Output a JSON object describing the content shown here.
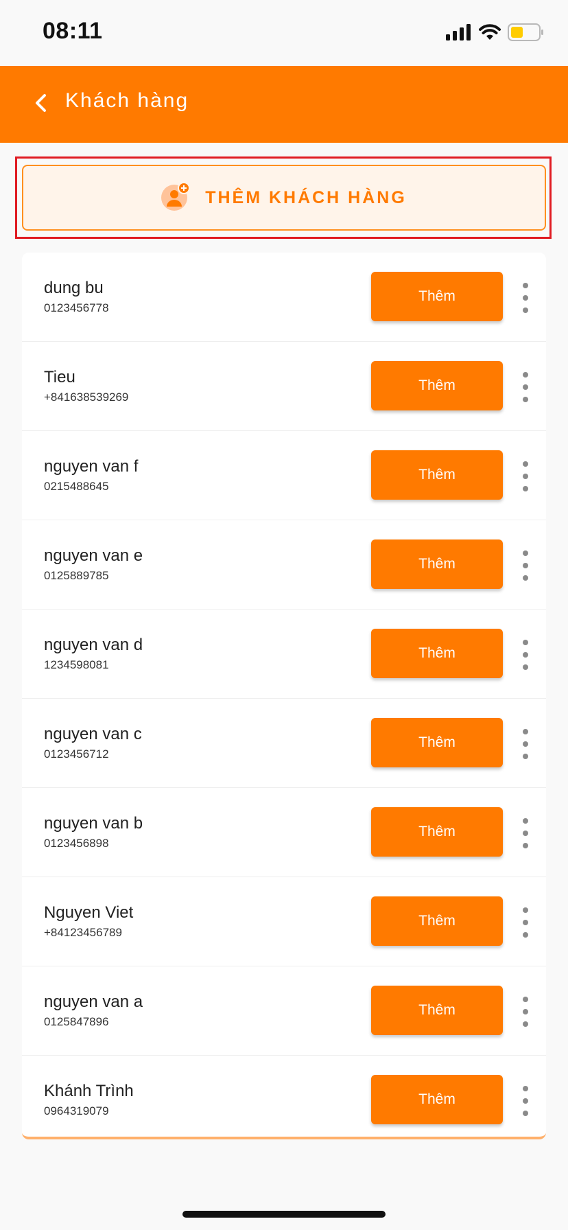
{
  "status_bar": {
    "time": "08:11",
    "icons": [
      "signal-icon",
      "wifi-icon",
      "battery-icon"
    ]
  },
  "header": {
    "title": "Khách hàng",
    "back_icon": "chevron-left-icon"
  },
  "add_customer": {
    "label": "THÊM KHÁCH HÀNG",
    "icon": "add-user-icon"
  },
  "customers": [
    {
      "name": "dung bu",
      "phone": "0123456778",
      "button_label": "Thêm"
    },
    {
      "name": "Tieu",
      "phone": "+841638539269",
      "button_label": "Thêm"
    },
    {
      "name": "nguyen van f",
      "phone": "0215488645",
      "button_label": "Thêm"
    },
    {
      "name": "nguyen van e",
      "phone": "0125889785",
      "button_label": "Thêm"
    },
    {
      "name": "nguyen van d",
      "phone": "1234598081",
      "button_label": "Thêm"
    },
    {
      "name": "nguyen van c",
      "phone": "0123456712",
      "button_label": "Thêm"
    },
    {
      "name": "nguyen van b",
      "phone": "0123456898",
      "button_label": "Thêm"
    },
    {
      "name": "Nguyen Viet",
      "phone": "+84123456789",
      "button_label": "Thêm"
    },
    {
      "name": "nguyen van a",
      "phone": "0125847896",
      "button_label": "Thêm"
    },
    {
      "name": "Khánh Trình",
      "phone": "0964319079",
      "button_label": "Thêm"
    }
  ],
  "colors": {
    "accent": "#ff7a00",
    "accent_light": "#fff4ea",
    "highlight": "#e01b22",
    "battery_fill": "#ffcc00"
  }
}
